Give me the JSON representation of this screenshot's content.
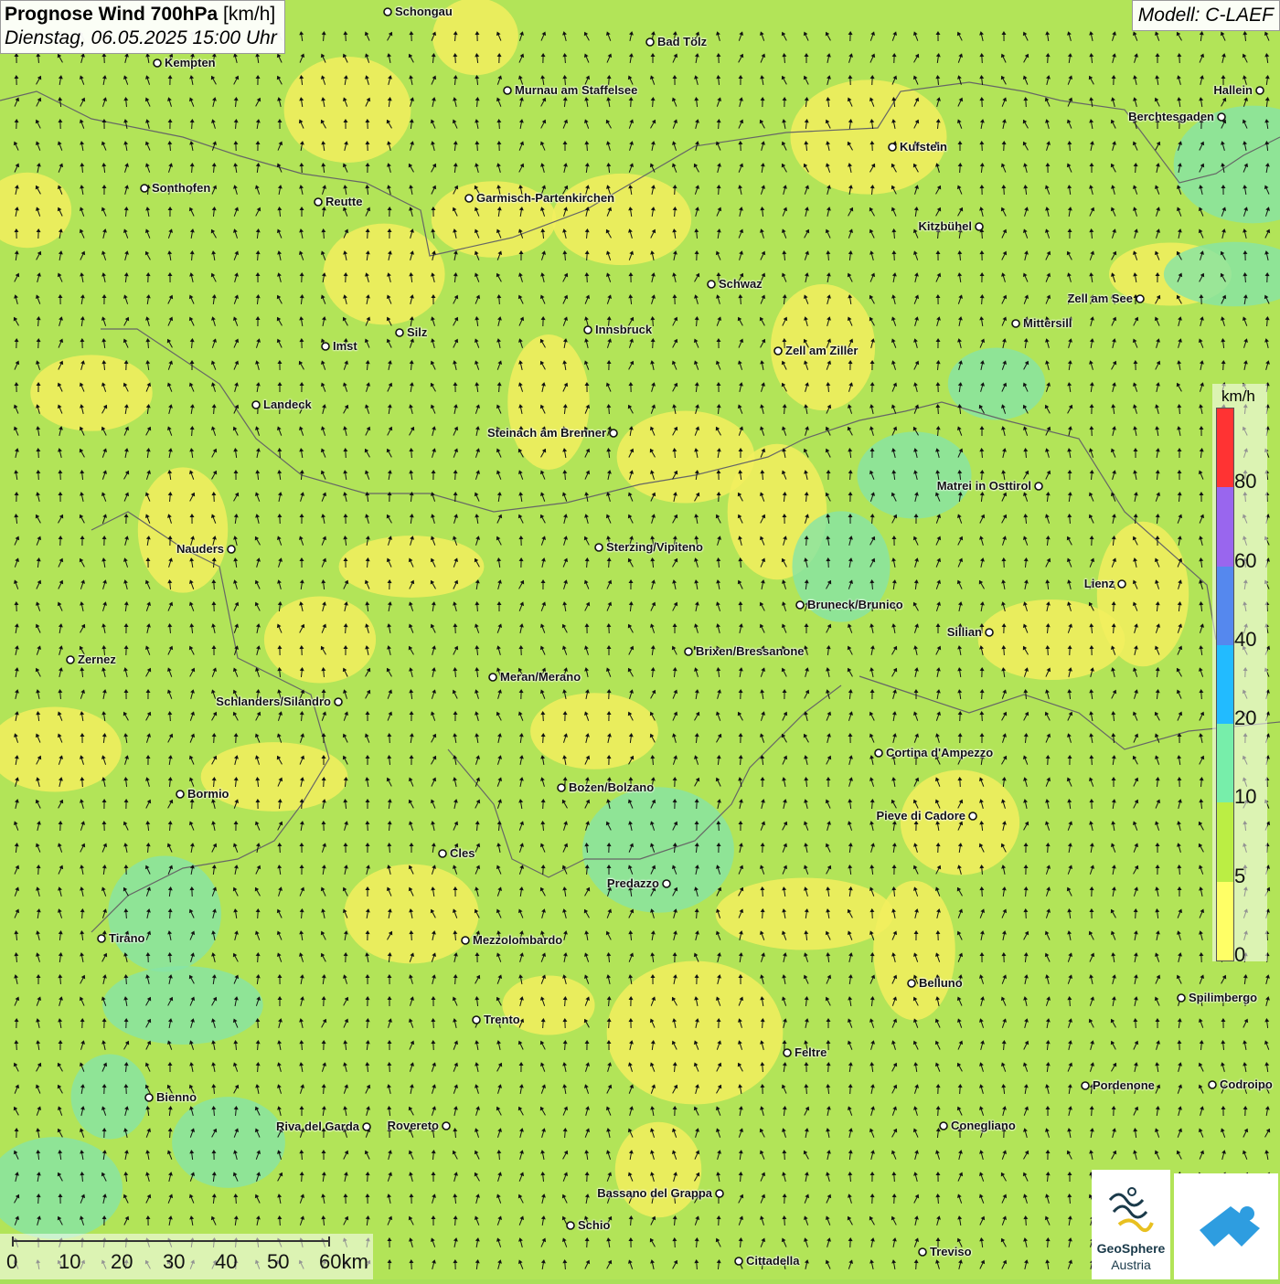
{
  "header": {
    "title": "Prognose Wind 700hPa",
    "unit": "[km/h]",
    "datetime": "Dienstag, 06.05.2025 15:00 Uhr",
    "model": "Modell: C-LAEF"
  },
  "cities": [
    {
      "name": "Schongau"
    },
    {
      "name": "Bad Tölz"
    },
    {
      "name": "Kempten"
    },
    {
      "name": "Murnau am Staffelsee"
    },
    {
      "name": "Hallein"
    },
    {
      "name": "Berchtesgaden"
    },
    {
      "name": "Kufstein"
    },
    {
      "name": "Sonthofen"
    },
    {
      "name": "Reutte"
    },
    {
      "name": "Garmisch-Partenkirchen"
    },
    {
      "name": "Kitzbühel"
    },
    {
      "name": "Schwaz"
    },
    {
      "name": "Zell am See"
    },
    {
      "name": "Mittersill"
    },
    {
      "name": "Silz"
    },
    {
      "name": "Innsbruck"
    },
    {
      "name": "Imst"
    },
    {
      "name": "Zell am Ziller"
    },
    {
      "name": "Landeck"
    },
    {
      "name": "Steinach am Brenner"
    },
    {
      "name": "Matrei in Osttirol"
    },
    {
      "name": "Nauders"
    },
    {
      "name": "Sterzing/Vipiteno"
    },
    {
      "name": "Lienz"
    },
    {
      "name": "Bruneck/Brunico"
    },
    {
      "name": "Sillian"
    },
    {
      "name": "Brixen/Bressanone"
    },
    {
      "name": "Zernez"
    },
    {
      "name": "Meran/Merano"
    },
    {
      "name": "Schlanders/Silandro"
    },
    {
      "name": "Cortina d'Ampezzo"
    },
    {
      "name": "Bozen/Bolzano"
    },
    {
      "name": "Bormio"
    },
    {
      "name": "Pieve di Cadore"
    },
    {
      "name": "Cles"
    },
    {
      "name": "Predazzo"
    },
    {
      "name": "Tirano"
    },
    {
      "name": "Mezzolombardo"
    },
    {
      "name": "Belluno"
    },
    {
      "name": "Spilimbergo"
    },
    {
      "name": "Trento"
    },
    {
      "name": "Feltre"
    },
    {
      "name": "Pordenone"
    },
    {
      "name": "Codroipo"
    },
    {
      "name": "Bienno"
    },
    {
      "name": "Riva del Garda"
    },
    {
      "name": "Rovereto"
    },
    {
      "name": "Conegliano"
    },
    {
      "name": "Bassano del Grappa"
    },
    {
      "name": "Schio"
    },
    {
      "name": "Treviso"
    },
    {
      "name": "Cittadella"
    }
  ],
  "legend": {
    "unit": "km/h",
    "ticks": [
      "80",
      "60",
      "40",
      "20",
      "10",
      "5",
      "0"
    ],
    "colors": [
      "#ff3333",
      "#9966ee",
      "#5588ee",
      "#22bbff",
      "#77eeaa",
      "#bbee44",
      "#ffff66"
    ]
  },
  "scalebar": {
    "labels": [
      "0",
      "10",
      "20",
      "30",
      "40",
      "50",
      "60km"
    ]
  },
  "wind_field": {
    "prevailing_direction": "from south (arrows pointing north)",
    "speed_range_kmh": [
      0,
      20
    ],
    "colors": {
      "calm": "#f4f05e",
      "light": "#b4e854",
      "moderate": "#7fe4a8"
    }
  },
  "logo": {
    "name_line1": "GeoSphere",
    "name_line2": "Austria"
  }
}
